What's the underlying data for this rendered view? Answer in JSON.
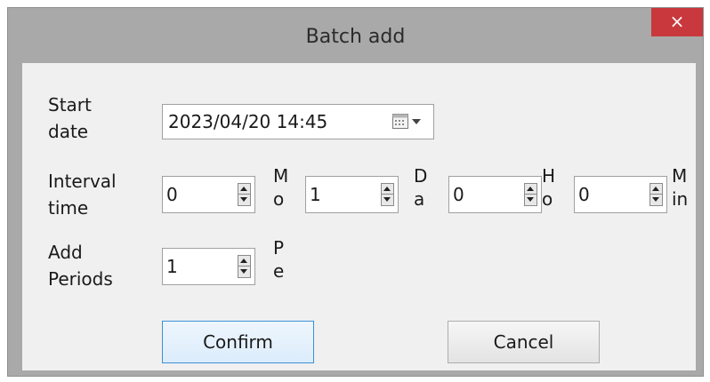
{
  "window": {
    "title": "Batch add",
    "close_glyph": "×"
  },
  "form": {
    "start_date_label": "Start\ndate",
    "start_date_value": "2023/04/20 14:45",
    "interval_label": "Interval\ntime",
    "add_periods_label": "Add\nPeriods",
    "interval": [
      {
        "value": "0",
        "unit": "M\no"
      },
      {
        "value": "1",
        "unit": "D\na"
      },
      {
        "value": "0",
        "unit": "H\no"
      },
      {
        "value": "0",
        "unit": "M\nin"
      }
    ],
    "periods": {
      "value": "1",
      "unit": "P\ne"
    }
  },
  "buttons": {
    "confirm": "Confirm",
    "cancel": "Cancel"
  },
  "colors": {
    "close_bg": "#c9383c",
    "frame": "#a9a9a9",
    "client_bg": "#f0f0f0",
    "focus_border": "#3c8fd6"
  },
  "icons": {
    "calendar": "calendar-icon",
    "dropdown": "chevron-down-icon",
    "spin": "spin-arrows-icon"
  }
}
